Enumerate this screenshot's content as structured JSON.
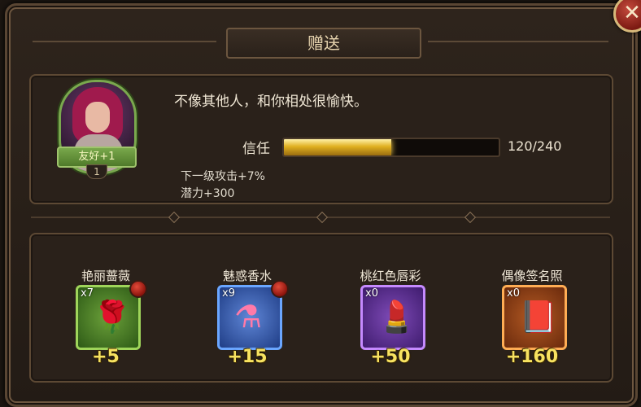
{
  "title": "赠送",
  "close_symbol": "✕",
  "character": {
    "favor_label": "友好+1",
    "level": "1",
    "quote": "不像其他人，和你相处很愉快。",
    "trust": {
      "label": "信任",
      "value_text": "120/240",
      "fraction": 0.5
    },
    "bonuses": [
      "下一级攻击+7%",
      "潜力+300"
    ]
  },
  "gifts": [
    {
      "name": "艳丽蔷薇",
      "count": "x7",
      "points": "+5",
      "icon": "rose-icon",
      "art": "🌹"
    },
    {
      "name": "魅惑香水",
      "count": "x9",
      "points": "+15",
      "icon": "perfume-icon",
      "art": "⚗"
    },
    {
      "name": "桃红色唇彩",
      "count": "x0",
      "points": "+50",
      "icon": "lipstick-icon",
      "art": "💄"
    },
    {
      "name": "偶像签名照",
      "count": "x0",
      "points": "+160",
      "icon": "photo-album-icon",
      "art": "📕"
    }
  ]
}
